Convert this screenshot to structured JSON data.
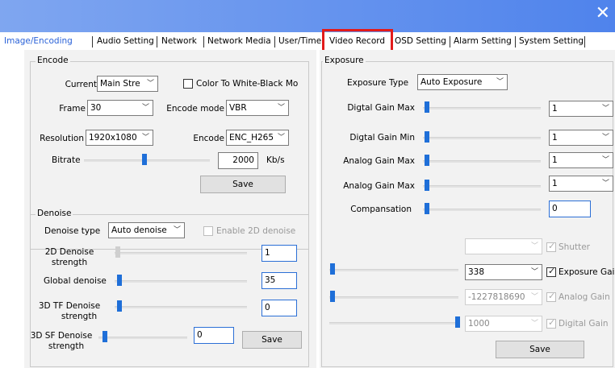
{
  "window": {
    "close_glyph": "✕"
  },
  "tabs": [
    {
      "label": "Image/Encoding"
    },
    {
      "label": "Audio Setting"
    },
    {
      "label": "Network"
    },
    {
      "label": "Network Media"
    },
    {
      "label": "User/Time"
    },
    {
      "label": "Video Record"
    },
    {
      "label": "OSD Setting"
    },
    {
      "label": "Alarm Setting"
    },
    {
      "label": "System Setting"
    }
  ],
  "encode": {
    "title": "Encode",
    "current_label": "Current",
    "current_value": "Main Stre",
    "color_bw_label": "Color To White-Black Mo",
    "frame_label": "Frame",
    "frame_value": "30",
    "encode_mode_label": "Encode mode",
    "encode_mode_value": "VBR",
    "resolution_label": "Resolution",
    "resolution_value": "1920x1080",
    "encode_label": "Encode",
    "encode_value": "ENC_H265",
    "bitrate_label": "Bitrate",
    "bitrate_value": "2000",
    "bitrate_unit": "Kb/s",
    "save_label": "Save"
  },
  "denoise": {
    "title": "Denoise",
    "type_label": "Denoise type",
    "type_value": "Auto denoise",
    "enable_2d_label": "Enable 2D denoise",
    "d2_label_1": "2D Denoise",
    "d2_label_2": "strength",
    "d2_value": "1",
    "global_label": "Global denoise",
    "global_value": "35",
    "d3tf_label_1": "3D TF Denoise",
    "d3tf_label_2": "strength",
    "d3tf_value": "0",
    "d3sf_label_1": "3D SF Denoise",
    "d3sf_label_2": "strength",
    "d3sf_value": "0",
    "save_label": "Save"
  },
  "exposure": {
    "title": "Exposure",
    "type_label": "Exposure Type",
    "type_value": "Auto Exposure",
    "digital_gain_max_label": "Digtal Gain Max",
    "digital_gain_max_value": "1",
    "digital_gain_min_label": "Digtal Gain Min",
    "digital_gain_min_value": "1",
    "analog_gain_max_label": "Analog Gain Max",
    "analog_gain_max_value": "1",
    "analog_gain_max2_label": "Analog Gain Max",
    "analog_gain_max2_value": "1",
    "compensation_label": "Compansation",
    "compensation_value": "0",
    "shutter_value": "",
    "shutter_label": "Shutter",
    "exposure_gain_value": "338",
    "exposure_gain_label": "Exposure Gain",
    "analog_gain_value": "-1227818690",
    "analog_gain_label": "Analog Gain",
    "digital_gain_value": "1000",
    "digital_gain_label": "Digital Gain",
    "save_label": "Save"
  },
  "colors": {
    "accent": "#1f6fd8",
    "title_bar": "#4f83ec",
    "highlight": "#e21b1b"
  }
}
